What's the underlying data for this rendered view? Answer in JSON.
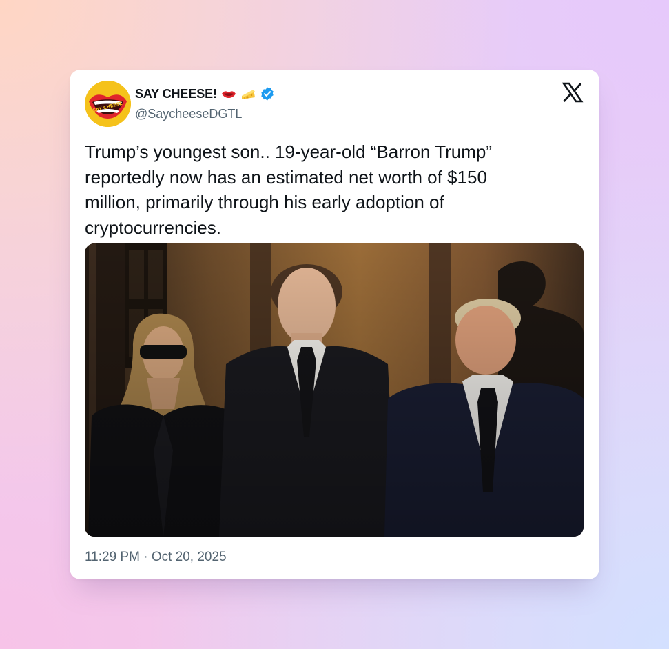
{
  "tweet": {
    "author": {
      "display_name": "SAY CHEESE!",
      "emojis": [
        "lips-emoji",
        "cheese-emoji"
      ],
      "verified": true,
      "handle": "@SaycheeseDGTL",
      "avatar_text": "SAY CHEESE"
    },
    "text": "Trump’s youngest son.. 19-year-old “Barron Trump”\nreportedly now has an estimated net worth of $150\nmillion, primarily through his early adoption of\ncryptocurrencies.",
    "media": {
      "kind": "photo",
      "people_count": 3
    },
    "time": "11:29 PM",
    "separator": "·",
    "date": "Oct 20, 2025"
  },
  "brand": {
    "logo": "x-logo-icon",
    "colors": {
      "verified": "#1d9bf0",
      "text": "#0f1419",
      "secondary": "#536471",
      "avatar_bg": "#f5c21b"
    }
  }
}
